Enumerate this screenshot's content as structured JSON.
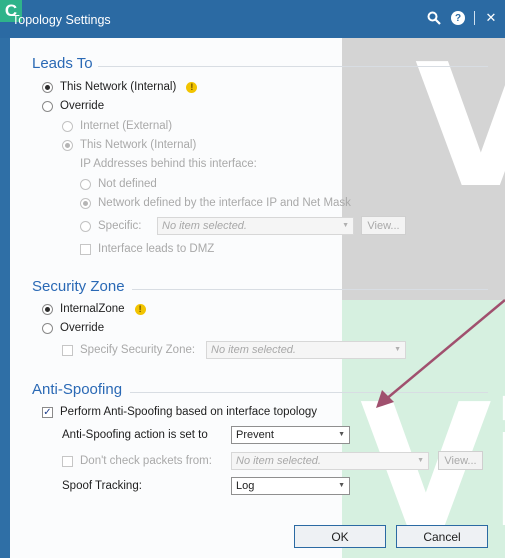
{
  "window": {
    "title": "Topology Settings",
    "app_icon_letter": "C"
  },
  "watermark": {
    "letter_top": "V",
    "letter_bottom": "Vi"
  },
  "leads_to": {
    "title": "Leads To",
    "this_network": "This Network (Internal)",
    "override": "Override",
    "internet": "Internet (External)",
    "this_network_internal": "This Network (Internal)",
    "ip_heading": "IP Addresses behind this interface:",
    "not_defined": "Not defined",
    "network_defined": "Network defined by the interface IP and Net Mask",
    "specific": "Specific:",
    "specific_placeholder": "No item selected.",
    "view": "View...",
    "dmz": "Interface leads to DMZ"
  },
  "security_zone": {
    "title": "Security Zone",
    "internal_zone": "InternalZone",
    "override": "Override",
    "specify": "Specify Security Zone:",
    "specify_placeholder": "No item selected."
  },
  "anti_spoofing": {
    "title": "Anti-Spoofing",
    "perform": "Perform Anti-Spoofing based on interface topology",
    "action_label": "Anti-Spoofing action is set to",
    "action_value": "Prevent",
    "dont_check": "Don't check packets from:",
    "dont_check_placeholder": "No item selected.",
    "view": "View...",
    "spoof_label": "Spoof Tracking:",
    "spoof_value": "Log"
  },
  "footer": {
    "ok": "OK",
    "cancel": "Cancel"
  }
}
